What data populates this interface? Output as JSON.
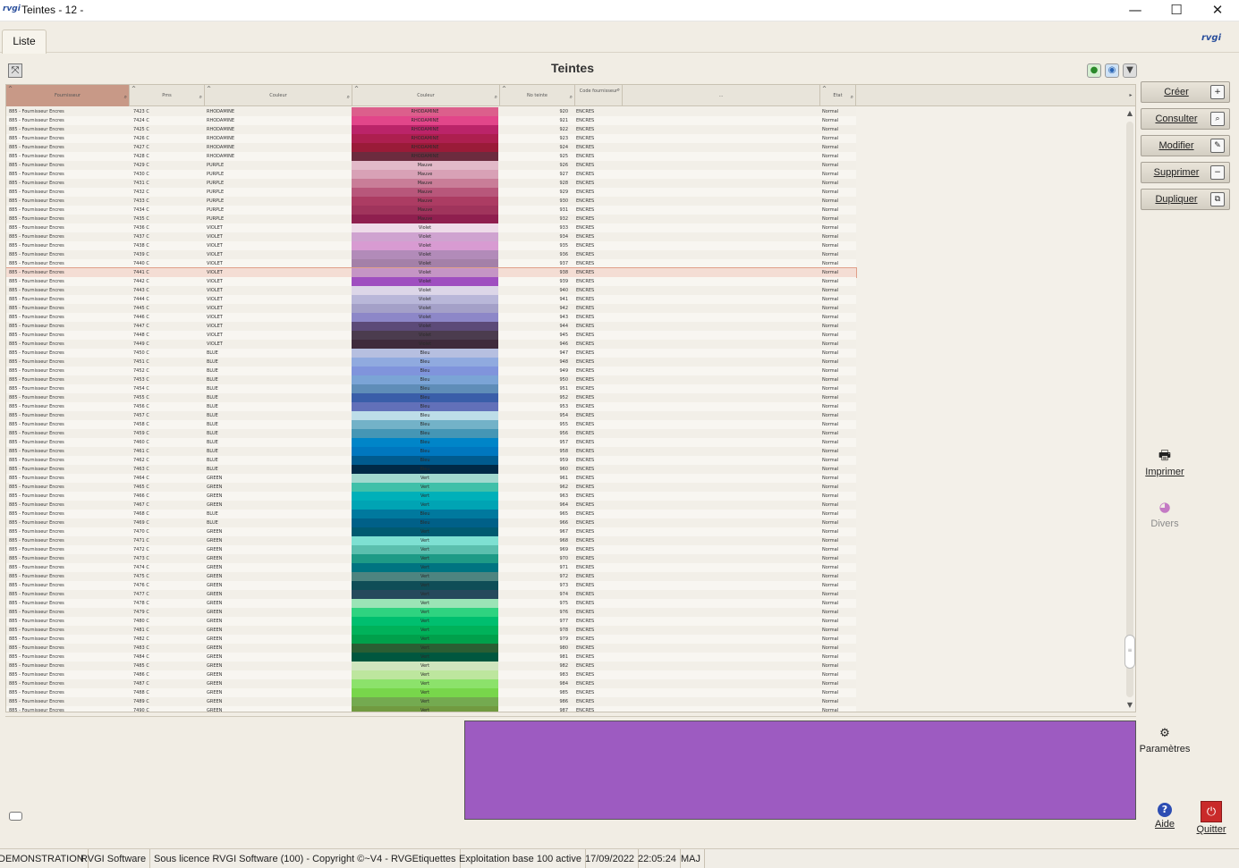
{
  "window": {
    "title": "Teintes - 12 -",
    "logo_text": "rvgi",
    "minimize": "—",
    "maximize": "☐",
    "close": "✕"
  },
  "tabs": [
    {
      "label": "Liste"
    }
  ],
  "mascot_text": "rvgi",
  "page_title": "Teintes",
  "columns": [
    {
      "key": "fournisseur",
      "label": "Fournisseur"
    },
    {
      "key": "pms",
      "label": "Pms"
    },
    {
      "key": "couleur",
      "label": "Couleur"
    },
    {
      "key": "couleur_swatch",
      "label": "Couleur"
    },
    {
      "key": "no_teinte",
      "label": "No teinte"
    },
    {
      "key": "code_fournisseur",
      "label": "Code fournisseur"
    },
    {
      "key": "blank",
      "label": "..."
    },
    {
      "key": "etat",
      "label": "Etat"
    }
  ],
  "rows": [
    {
      "f": "885 - Fournisseur Encres",
      "p": "7423 C",
      "c": "RHODAMINE",
      "sw": "#dc5f8c",
      "lbl": "RHODAMINE",
      "no": "920",
      "cf": "ENCRES",
      "e": "Normal"
    },
    {
      "f": "885 - Fournisseur Encres",
      "p": "7424 C",
      "c": "RHODAMINE",
      "sw": "#e2468a",
      "lbl": "RHODAMINE",
      "no": "921",
      "cf": "ENCRES",
      "e": "Normal"
    },
    {
      "f": "885 - Fournisseur Encres",
      "p": "7425 C",
      "c": "RHODAMINE",
      "sw": "#bb2469",
      "lbl": "RHODAMINE",
      "no": "922",
      "cf": "ENCRES",
      "e": "Normal"
    },
    {
      "f": "885 - Fournisseur Encres",
      "p": "7426 C",
      "c": "RHODAMINE",
      "sw": "#ad1f4f",
      "lbl": "RHODAMINE",
      "no": "923",
      "cf": "ENCRES",
      "e": "Normal"
    },
    {
      "f": "885 - Fournisseur Encres",
      "p": "7427 C",
      "c": "RHODAMINE",
      "sw": "#9a1b38",
      "lbl": "RHODAMINE",
      "no": "924",
      "cf": "ENCRES",
      "e": "Normal"
    },
    {
      "f": "885 - Fournisseur Encres",
      "p": "7428 C",
      "c": "RHODAMINE",
      "sw": "#6c2b3e",
      "lbl": "RHODAMINE",
      "no": "925",
      "cf": "ENCRES",
      "e": "Normal"
    },
    {
      "f": "885 - Fournisseur Encres",
      "p": "7429 C",
      "c": "PURPLE",
      "sw": "#e2b9c8",
      "lbl": "Mauve",
      "no": "926",
      "cf": "ENCRES",
      "e": "Normal"
    },
    {
      "f": "885 - Fournisseur Encres",
      "p": "7430 C",
      "c": "PURPLE",
      "sw": "#d8a1b6",
      "lbl": "Mauve",
      "no": "927",
      "cf": "ENCRES",
      "e": "Normal"
    },
    {
      "f": "885 - Fournisseur Encres",
      "p": "7431 C",
      "c": "PURPLE",
      "sw": "#c97d98",
      "lbl": "Mauve",
      "no": "928",
      "cf": "ENCRES",
      "e": "Normal"
    },
    {
      "f": "885 - Fournisseur Encres",
      "p": "7432 C",
      "c": "PURPLE",
      "sw": "#b8577b",
      "lbl": "Mauve",
      "no": "929",
      "cf": "ENCRES",
      "e": "Normal"
    },
    {
      "f": "885 - Fournisseur Encres",
      "p": "7433 C",
      "c": "PURPLE",
      "sw": "#ac3c63",
      "lbl": "Mauve",
      "no": "930",
      "cf": "ENCRES",
      "e": "Normal"
    },
    {
      "f": "885 - Fournisseur Encres",
      "p": "7434 C",
      "c": "PURPLE",
      "sw": "#a0345c",
      "lbl": "Mauve",
      "no": "931",
      "cf": "ENCRES",
      "e": "Normal"
    },
    {
      "f": "885 - Fournisseur Encres",
      "p": "7435 C",
      "c": "PURPLE",
      "sw": "#8f1f4f",
      "lbl": "Mauve",
      "no": "932",
      "cf": "ENCRES",
      "e": "Normal"
    },
    {
      "f": "885 - Fournisseur Encres",
      "p": "7436 C",
      "c": "VIOLET",
      "sw": "#eedbe9",
      "lbl": "Violet",
      "no": "933",
      "cf": "ENCRES",
      "e": "Normal"
    },
    {
      "f": "885 - Fournisseur Encres",
      "p": "7437 C",
      "c": "VIOLET",
      "sw": "#cfa3d0",
      "lbl": "Violet",
      "no": "934",
      "cf": "ENCRES",
      "e": "Normal"
    },
    {
      "f": "885 - Fournisseur Encres",
      "p": "7438 C",
      "c": "VIOLET",
      "sw": "#d89bd2",
      "lbl": "Violet",
      "no": "935",
      "cf": "ENCRES",
      "e": "Normal"
    },
    {
      "f": "885 - Fournisseur Encres",
      "p": "7439 C",
      "c": "VIOLET",
      "sw": "#b28bb9",
      "lbl": "Violet",
      "no": "936",
      "cf": "ENCRES",
      "e": "Normal"
    },
    {
      "f": "885 - Fournisseur Encres",
      "p": "7440 C",
      "c": "VIOLET",
      "sw": "#a480a8",
      "lbl": "Violet",
      "no": "937",
      "cf": "ENCRES",
      "e": "Normal"
    },
    {
      "f": "885 - Fournisseur Encres",
      "p": "7441 C",
      "c": "VIOLET",
      "sw": "#c595c5",
      "lbl": "Violet",
      "no": "938",
      "cf": "ENCRES",
      "e": "Normal",
      "cur": true
    },
    {
      "f": "885 - Fournisseur Encres",
      "p": "7442 C",
      "c": "VIOLET",
      "sw": "#9f4fc0",
      "lbl": "Violet",
      "no": "939",
      "cf": "ENCRES",
      "e": "Normal"
    },
    {
      "f": "885 - Fournisseur Encres",
      "p": "7443 C",
      "c": "VIOLET",
      "sw": "#dcd6e8",
      "lbl": "Violet",
      "no": "940",
      "cf": "ENCRES",
      "e": "Normal"
    },
    {
      "f": "885 - Fournisseur Encres",
      "p": "7444 C",
      "c": "VIOLET",
      "sw": "#b9b7d9",
      "lbl": "Violet",
      "no": "941",
      "cf": "ENCRES",
      "e": "Normal"
    },
    {
      "f": "885 - Fournisseur Encres",
      "p": "7445 C",
      "c": "VIOLET",
      "sw": "#a4a0c8",
      "lbl": "Violet",
      "no": "942",
      "cf": "ENCRES",
      "e": "Normal"
    },
    {
      "f": "885 - Fournisseur Encres",
      "p": "7446 C",
      "c": "VIOLET",
      "sw": "#8d87c8",
      "lbl": "Violet",
      "no": "943",
      "cf": "ENCRES",
      "e": "Normal"
    },
    {
      "f": "885 - Fournisseur Encres",
      "p": "7447 C",
      "c": "VIOLET",
      "sw": "#5c4a78",
      "lbl": "Violet",
      "no": "944",
      "cf": "ENCRES",
      "e": "Normal"
    },
    {
      "f": "885 - Fournisseur Encres",
      "p": "7448 C",
      "c": "VIOLET",
      "sw": "#4b3c4e",
      "lbl": "Violet",
      "no": "945",
      "cf": "ENCRES",
      "e": "Normal"
    },
    {
      "f": "885 - Fournisseur Encres",
      "p": "7449 C",
      "c": "VIOLET",
      "sw": "#3f2a3c",
      "lbl": "Violet",
      "no": "946",
      "cf": "ENCRES",
      "e": "Normal"
    },
    {
      "f": "885 - Fournisseur Encres",
      "p": "7450 C",
      "c": "BLUE",
      "sw": "#b6bfe0",
      "lbl": "Bleu",
      "no": "947",
      "cf": "ENCRES",
      "e": "Normal"
    },
    {
      "f": "885 - Fournisseur Encres",
      "p": "7451 C",
      "c": "BLUE",
      "sw": "#90aadf",
      "lbl": "Bleu",
      "no": "948",
      "cf": "ENCRES",
      "e": "Normal"
    },
    {
      "f": "885 - Fournisseur Encres",
      "p": "7452 C",
      "c": "BLUE",
      "sw": "#8094dc",
      "lbl": "Bleu",
      "no": "949",
      "cf": "ENCRES",
      "e": "Normal"
    },
    {
      "f": "885 - Fournisseur Encres",
      "p": "7453 C",
      "c": "BLUE",
      "sw": "#7ba4d6",
      "lbl": "Bleu",
      "no": "950",
      "cf": "ENCRES",
      "e": "Normal"
    },
    {
      "f": "885 - Fournisseur Encres",
      "p": "7454 C",
      "c": "BLUE",
      "sw": "#5f8db8",
      "lbl": "Bleu",
      "no": "951",
      "cf": "ENCRES",
      "e": "Normal"
    },
    {
      "f": "885 - Fournisseur Encres",
      "p": "7455 C",
      "c": "BLUE",
      "sw": "#3a5ea9",
      "lbl": "Bleu",
      "no": "952",
      "cf": "ENCRES",
      "e": "Normal"
    },
    {
      "f": "885 - Fournisseur Encres",
      "p": "7456 C",
      "c": "BLUE",
      "sw": "#6270b9",
      "lbl": "Bleu",
      "no": "953",
      "cf": "ENCRES",
      "e": "Normal"
    },
    {
      "f": "885 - Fournisseur Encres",
      "p": "7457 C",
      "c": "BLUE",
      "sw": "#bddde8",
      "lbl": "Bleu",
      "no": "954",
      "cf": "ENCRES",
      "e": "Normal"
    },
    {
      "f": "885 - Fournisseur Encres",
      "p": "7458 C",
      "c": "BLUE",
      "sw": "#73b2c8",
      "lbl": "Bleu",
      "no": "955",
      "cf": "ENCRES",
      "e": "Normal"
    },
    {
      "f": "885 - Fournisseur Encres",
      "p": "7459 C",
      "c": "BLUE",
      "sw": "#4596b5",
      "lbl": "Bleu",
      "no": "956",
      "cf": "ENCRES",
      "e": "Normal"
    },
    {
      "f": "885 - Fournisseur Encres",
      "p": "7460 C",
      "c": "BLUE",
      "sw": "#0085c8",
      "lbl": "Bleu",
      "no": "957",
      "cf": "ENCRES",
      "e": "Normal"
    },
    {
      "f": "885 - Fournisseur Encres",
      "p": "7461 C",
      "c": "BLUE",
      "sw": "#0077bf",
      "lbl": "Bleu",
      "no": "958",
      "cf": "ENCRES",
      "e": "Normal"
    },
    {
      "f": "885 - Fournisseur Encres",
      "p": "7462 C",
      "c": "BLUE",
      "sw": "#005b8f",
      "lbl": "Bleu",
      "no": "959",
      "cf": "ENCRES",
      "e": "Normal"
    },
    {
      "f": "885 - Fournisseur Encres",
      "p": "7463 C",
      "c": "BLUE",
      "sw": "#002a47",
      "lbl": "Bleu",
      "no": "960",
      "cf": "ENCRES",
      "e": "Normal"
    },
    {
      "f": "885 - Fournisseur Encres",
      "p": "7464 C",
      "c": "GREEN",
      "sw": "#a2d9cf",
      "lbl": "Vert",
      "no": "961",
      "cf": "ENCRES",
      "e": "Normal"
    },
    {
      "f": "885 - Fournisseur Encres",
      "p": "7465 C",
      "c": "GREEN",
      "sw": "#40c0a9",
      "lbl": "Vert",
      "no": "962",
      "cf": "ENCRES",
      "e": "Normal"
    },
    {
      "f": "885 - Fournisseur Encres",
      "p": "7466 C",
      "c": "GREEN",
      "sw": "#00b0b9",
      "lbl": "Vert",
      "no": "963",
      "cf": "ENCRES",
      "e": "Normal"
    },
    {
      "f": "885 - Fournisseur Encres",
      "p": "7467 C",
      "c": "GREEN",
      "sw": "#00a4b4",
      "lbl": "Vert",
      "no": "964",
      "cf": "ENCRES",
      "e": "Normal"
    },
    {
      "f": "885 - Fournisseur Encres",
      "p": "7468 C",
      "c": "BLUE",
      "sw": "#00799e",
      "lbl": "Bleu",
      "no": "965",
      "cf": "ENCRES",
      "e": "Normal"
    },
    {
      "f": "885 - Fournisseur Encres",
      "p": "7469 C",
      "c": "BLUE",
      "sw": "#006088",
      "lbl": "Bleu",
      "no": "966",
      "cf": "ENCRES",
      "e": "Normal"
    },
    {
      "f": "885 - Fournisseur Encres",
      "p": "7470 C",
      "c": "GREEN",
      "sw": "#005a70",
      "lbl": "Vert",
      "no": "967",
      "cf": "ENCRES",
      "e": "Normal"
    },
    {
      "f": "885 - Fournisseur Encres",
      "p": "7471 C",
      "c": "GREEN",
      "sw": "#7ee0d2",
      "lbl": "Vert",
      "no": "968",
      "cf": "ENCRES",
      "e": "Normal"
    },
    {
      "f": "885 - Fournisseur Encres",
      "p": "7472 C",
      "c": "GREEN",
      "sw": "#5bbfae",
      "lbl": "Vert",
      "no": "969",
      "cf": "ENCRES",
      "e": "Normal"
    },
    {
      "f": "885 - Fournisseur Encres",
      "p": "7473 C",
      "c": "GREEN",
      "sw": "#1e9a86",
      "lbl": "Vert",
      "no": "970",
      "cf": "ENCRES",
      "e": "Normal"
    },
    {
      "f": "885 - Fournisseur Encres",
      "p": "7474 C",
      "c": "GREEN",
      "sw": "#007481",
      "lbl": "Vert",
      "no": "971",
      "cf": "ENCRES",
      "e": "Normal"
    },
    {
      "f": "885 - Fournisseur Encres",
      "p": "7475 C",
      "c": "GREEN",
      "sw": "#4e8480",
      "lbl": "Vert",
      "no": "972",
      "cf": "ENCRES",
      "e": "Normal"
    },
    {
      "f": "885 - Fournisseur Encres",
      "p": "7476 C",
      "c": "GREEN",
      "sw": "#0f4d57",
      "lbl": "Vert",
      "no": "973",
      "cf": "ENCRES",
      "e": "Normal"
    },
    {
      "f": "885 - Fournisseur Encres",
      "p": "7477 C",
      "c": "GREEN",
      "sw": "#264a5c",
      "lbl": "Vert",
      "no": "974",
      "cf": "ENCRES",
      "e": "Normal"
    },
    {
      "f": "885 - Fournisseur Encres",
      "p": "7478 C",
      "c": "GREEN",
      "sw": "#9be4b6",
      "lbl": "Vert",
      "no": "975",
      "cf": "ENCRES",
      "e": "Normal"
    },
    {
      "f": "885 - Fournisseur Encres",
      "p": "7479 C",
      "c": "GREEN",
      "sw": "#2fd380",
      "lbl": "Vert",
      "no": "976",
      "cf": "ENCRES",
      "e": "Normal"
    },
    {
      "f": "885 - Fournisseur Encres",
      "p": "7480 C",
      "c": "GREEN",
      "sw": "#00bf6f",
      "lbl": "Vert",
      "no": "977",
      "cf": "ENCRES",
      "e": "Normal"
    },
    {
      "f": "885 - Fournisseur Encres",
      "p": "7481 C",
      "c": "GREEN",
      "sw": "#00b25a",
      "lbl": "Vert",
      "no": "978",
      "cf": "ENCRES",
      "e": "Normal"
    },
    {
      "f": "885 - Fournisseur Encres",
      "p": "7482 C",
      "c": "GREEN",
      "sw": "#00a04b",
      "lbl": "Vert",
      "no": "979",
      "cf": "ENCRES",
      "e": "Normal"
    },
    {
      "f": "885 - Fournisseur Encres",
      "p": "7483 C",
      "c": "GREEN",
      "sw": "#2a5e33",
      "lbl": "Vert",
      "no": "980",
      "cf": "ENCRES",
      "e": "Normal"
    },
    {
      "f": "885 - Fournisseur Encres",
      "p": "7484 C",
      "c": "GREEN",
      "sw": "#00573f",
      "lbl": "Vert",
      "no": "981",
      "cf": "ENCRES",
      "e": "Normal"
    },
    {
      "f": "885 - Fournisseur Encres",
      "p": "7485 C",
      "c": "GREEN",
      "sw": "#d0e5be",
      "lbl": "Vert",
      "no": "982",
      "cf": "ENCRES",
      "e": "Normal"
    },
    {
      "f": "885 - Fournisseur Encres",
      "p": "7486 C",
      "c": "GREEN",
      "sw": "#bde69e",
      "lbl": "Vert",
      "no": "983",
      "cf": "ENCRES",
      "e": "Normal"
    },
    {
      "f": "885 - Fournisseur Encres",
      "p": "7487 C",
      "c": "GREEN",
      "sw": "#8ce26b",
      "lbl": "Vert",
      "no": "984",
      "cf": "ENCRES",
      "e": "Normal"
    },
    {
      "f": "885 - Fournisseur Encres",
      "p": "7488 C",
      "c": "GREEN",
      "sw": "#78d64b",
      "lbl": "Vert",
      "no": "985",
      "cf": "ENCRES",
      "e": "Normal"
    },
    {
      "f": "885 - Fournisseur Encres",
      "p": "7489 C",
      "c": "GREEN",
      "sw": "#74aa50",
      "lbl": "Vert",
      "no": "986",
      "cf": "ENCRES",
      "e": "Normal"
    },
    {
      "f": "885 - Fournisseur Encres",
      "p": "7490 C",
      "c": "GREEN",
      "sw": "#719a40",
      "lbl": "Vert",
      "no": "987",
      "cf": "ENCRES",
      "e": "Normal"
    }
  ],
  "preview_color": "#9d5bc1",
  "actions": [
    {
      "label": "Créer",
      "icon": "create-icon",
      "glyph": "+"
    },
    {
      "label": "Consulter",
      "icon": "search-icon",
      "glyph": "⌕"
    },
    {
      "label": "Modifier",
      "icon": "edit-icon",
      "glyph": "✎"
    },
    {
      "label": "Supprimer",
      "icon": "delete-icon",
      "glyph": "−"
    },
    {
      "label": "Dupliquer",
      "icon": "duplicate-icon",
      "glyph": "⧉"
    }
  ],
  "side": {
    "imprimer": "Imprimer",
    "divers": "Divers",
    "parametres": "Paramètres",
    "aide": "Aide",
    "quitter": "Quitter"
  },
  "status": [
    "DEMONSTRATION",
    "RVGI Software",
    "Sous licence RVGI Software (100) - Copyright ©~V4 - RVGEtiquettes",
    "Exploitation base 100 active",
    "17/09/2022",
    "22:05:24",
    "MAJ"
  ],
  "colors": {
    "accent_header": "#c89987",
    "current_row": "#f4ddd4"
  }
}
